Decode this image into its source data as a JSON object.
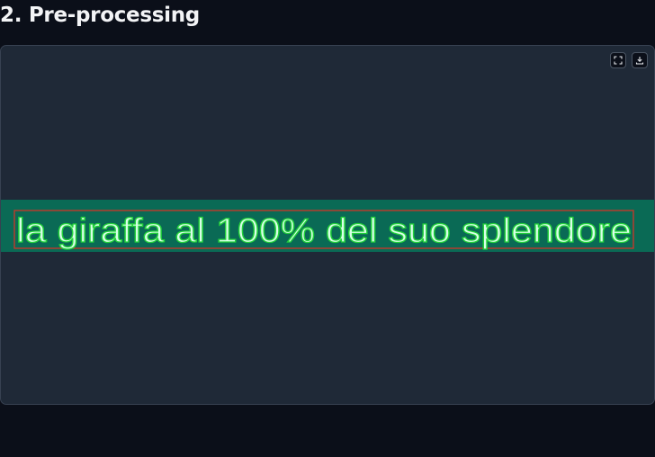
{
  "section": {
    "title": "2. Pre-processing"
  },
  "image_panel": {
    "toolbar": {
      "fullscreen_icon": "fullscreen-icon",
      "download_icon": "download-icon"
    },
    "ocr_text": "la giraffa al 100% del suo splendore",
    "colors": {
      "panel_background": "#1f2937",
      "strip_background": "#0a6a55",
      "glyph_fill": "#d9ffe9",
      "glyph_outline": "#22d13a",
      "line_box": "#c0392b"
    }
  }
}
